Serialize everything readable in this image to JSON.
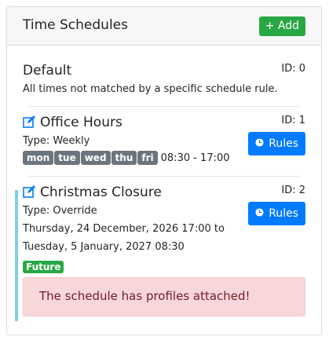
{
  "header": {
    "title": "Time Schedules",
    "add_label": "+ Add"
  },
  "default_schedule": {
    "name": "Default",
    "id_label": "ID: 0",
    "description": "All times not matched by a specific schedule rule."
  },
  "schedules": [
    {
      "name": "Office Hours",
      "id_label": "ID: 1",
      "type": "Type: Weekly",
      "days": [
        "mon",
        "tue",
        "wed",
        "thu",
        "fri"
      ],
      "time_range": "08:30 - 17:00",
      "rules_label": "Rules"
    },
    {
      "name": "Christmas Closure",
      "id_label": "ID: 2",
      "type": "Type: Override",
      "start": "Thursday, 24 December, 2026 17:00 to",
      "end": "Tuesday, 5 January, 2027 08:30",
      "badge": "Future",
      "rules_label": "Rules",
      "alert": "The schedule has profiles attached!"
    }
  ],
  "colors": {
    "add_button": "#28a745",
    "rules_button": "#007bff",
    "day_badge": "#6c757d",
    "future_badge": "#28a745",
    "alert_bg": "#f8d7da",
    "alert_text": "#721c24",
    "accent_bar": "#7fd0e0"
  },
  "icons": {
    "edit": "edit-icon",
    "clock": "clock-icon"
  }
}
